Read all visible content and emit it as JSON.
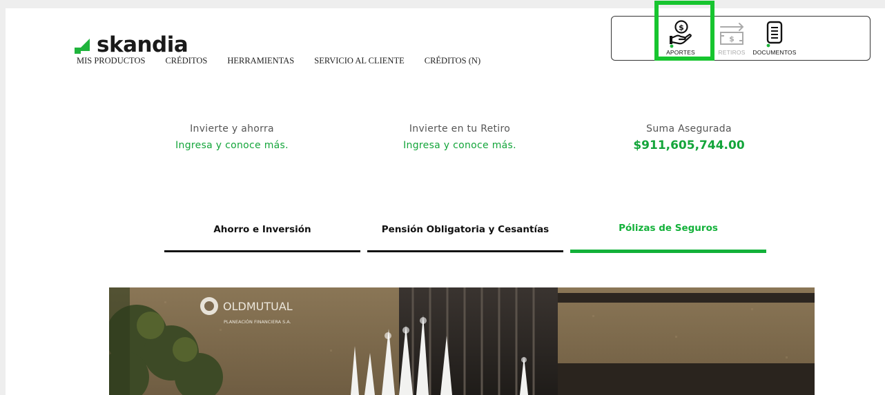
{
  "brand": {
    "name": "skandia",
    "color": "#1fb43c"
  },
  "nav": {
    "items": [
      {
        "label": "MIS PRODUCTOS"
      },
      {
        "label": "CRÉDITOS"
      },
      {
        "label": "HERRAMIENTAS"
      },
      {
        "label": "SERVICIO AL CLIENTE"
      },
      {
        "label": "CRÉDITOS (N)"
      }
    ]
  },
  "quick_actions": {
    "aportes": {
      "label": "APORTES",
      "icon": "hand-coin-icon"
    },
    "retiros": {
      "label": "RETIROS",
      "icon": "cash-withdraw-icon",
      "disabled": true
    },
    "documentos": {
      "label": "DOCUMENTOS",
      "icon": "document-icon"
    }
  },
  "summary": [
    {
      "title": "Invierte y ahorra",
      "link": "Ingresa y conoce más."
    },
    {
      "title": "Invierte en tu Retiro",
      "link": "Ingresa y conoce más."
    },
    {
      "title": "Suma Asegurada",
      "value": "$911,605,744.00"
    }
  ],
  "tabs": [
    {
      "label": "Ahorro e Inversión"
    },
    {
      "label": "Pensión Obligatoria y Cesantías"
    },
    {
      "label": "Pólizas de Seguros",
      "active": true
    }
  ],
  "hero": {
    "sign": "OLDMUTUAL",
    "sign_sub": "PLANEACIÓN FINANCIERA S.A."
  },
  "colors": {
    "accent": "#13b13a",
    "highlight": "#17c52f",
    "text": "#111111"
  }
}
